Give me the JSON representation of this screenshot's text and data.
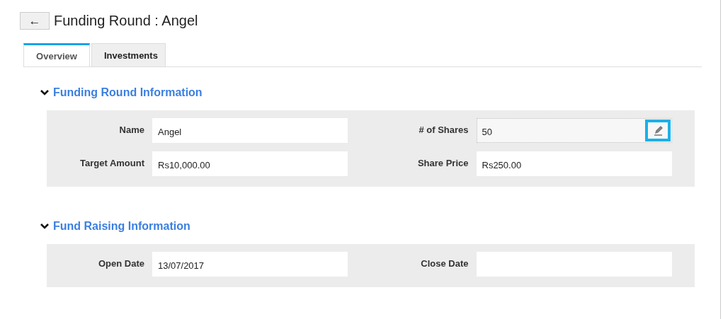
{
  "header": {
    "back_button": "←",
    "title": "Funding Round : Angel"
  },
  "tabs": [
    {
      "label": "Overview",
      "selected": true
    },
    {
      "label": "Investments",
      "selected": false
    }
  ],
  "sections": [
    {
      "title": "Funding Round Information",
      "expanded": true,
      "fields": [
        {
          "label": "Name",
          "value": "Angel",
          "hovered": false
        },
        {
          "label": "# of Shares",
          "value": "50",
          "hovered": true
        },
        {
          "label": "Target Amount",
          "value": "Rs10,000.00",
          "hovered": false
        },
        {
          "label": "Share Price",
          "value": "Rs250.00",
          "hovered": false
        }
      ]
    },
    {
      "title": "Fund Raising Information",
      "expanded": true,
      "fields": [
        {
          "label": "Open Date",
          "value": "13/07/2017",
          "hovered": false
        },
        {
          "label": "Close Date",
          "hovered": false
        }
      ]
    }
  ]
}
